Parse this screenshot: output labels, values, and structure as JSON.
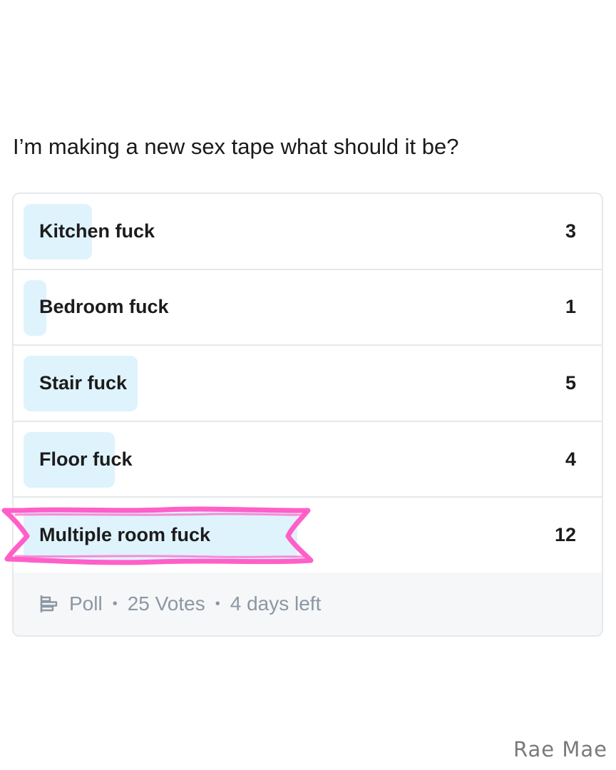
{
  "post": {
    "question": "I’m making a new sex tape what should it be?"
  },
  "poll": {
    "options": [
      {
        "label": "Kitchen fuck",
        "votes": 3,
        "share": 0.12
      },
      {
        "label": "Bedroom fuck",
        "votes": 1,
        "share": 0.04
      },
      {
        "label": "Stair fuck",
        "votes": 5,
        "share": 0.2
      },
      {
        "label": "Floor fuck",
        "votes": 4,
        "share": 0.16
      },
      {
        "label": "Multiple room fuck",
        "votes": 12,
        "share": 0.48,
        "highlighted": true
      }
    ],
    "footer": {
      "type_label": "Poll",
      "votes_label": "25 Votes",
      "time_left": "4 days left",
      "icon": "poll-icon"
    }
  },
  "colors": {
    "bar_fill": "#dff3fd",
    "highlight_marker": "#ff5fc8",
    "footer_text": "#8b97a3"
  },
  "watermark": "Rae Mae"
}
